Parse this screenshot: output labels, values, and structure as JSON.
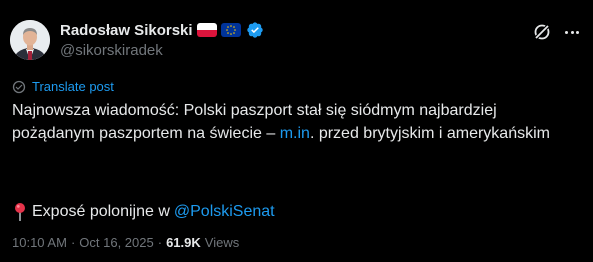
{
  "author": {
    "display_name": "Radosław Sikorski",
    "handle": "@sikorskiradek",
    "flags": [
      "flag-poland-icon",
      "flag-eu-icon"
    ],
    "verified_color": "#1d9bf0"
  },
  "actions": {
    "grok_icon": "grok-icon",
    "more_icon": "more-icon"
  },
  "translate": {
    "icon": "translate-icon",
    "label": "Translate post"
  },
  "post": {
    "text_before_link": "Najnowsza wiadomość: Polski paszport stał się siódmym najbardziej pożądanym paszportem na świecie – ",
    "link_text": "m.in",
    "text_after_link": ". przed brytyjskim i amerykańskim",
    "line2_icon": "round-pushpin-icon",
    "line2_text": "Exposé polonijne w",
    "mention": "@PolskiSenat"
  },
  "meta": {
    "time": "10:10 AM",
    "separator": "·",
    "date": "Oct 16, 2025",
    "views_count": "61.9K",
    "views_label": "Views"
  },
  "colors": {
    "background": "#000000",
    "text": "#e7e9ea",
    "secondary": "#71767b",
    "accent": "#1d9bf0"
  }
}
